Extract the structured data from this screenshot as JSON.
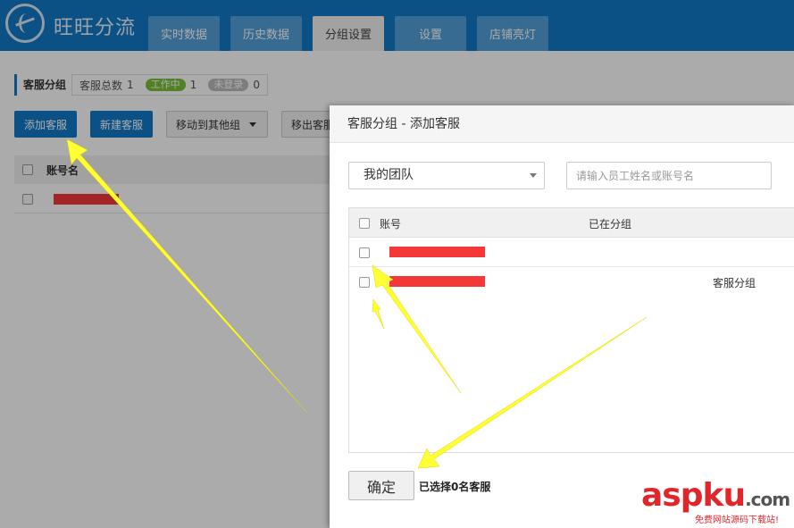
{
  "app": {
    "title": "旺旺分流"
  },
  "nav": {
    "tabs": [
      "实时数据",
      "历史数据",
      "分组设置",
      "设置",
      "店铺亮灯"
    ]
  },
  "page": {
    "group_title": "客服分组",
    "total_label": "客服总数",
    "total_count": "1",
    "working_label": "工作中",
    "working_count": "1",
    "offline_label": "未登录",
    "offline_count": "0",
    "buttons": {
      "add": "添加客服",
      "new": "新建客服",
      "move": "移动到其他组",
      "remove": "移出客服"
    },
    "table": {
      "col_account": "账号名"
    }
  },
  "modal": {
    "title": "客服分组 - 添加客服",
    "team_select": "我的团队",
    "search_placeholder": "请输入员工姓名或账号名",
    "col_account": "账号",
    "col_group": "已在分组",
    "rows": [
      {
        "group": ""
      },
      {
        "group": "客服分组"
      }
    ],
    "confirm": "确定",
    "selected_text": "已选择0名客服"
  },
  "watermark": {
    "brand_a": "asp",
    "brand_b": "ku",
    "brand_c": ".com",
    "sub": "免费网站源码下载站!"
  },
  "colors": {
    "header": "#1379c8",
    "arrow": "#ffff33",
    "redaction": "#f43838",
    "working": "#7bbf3a"
  }
}
